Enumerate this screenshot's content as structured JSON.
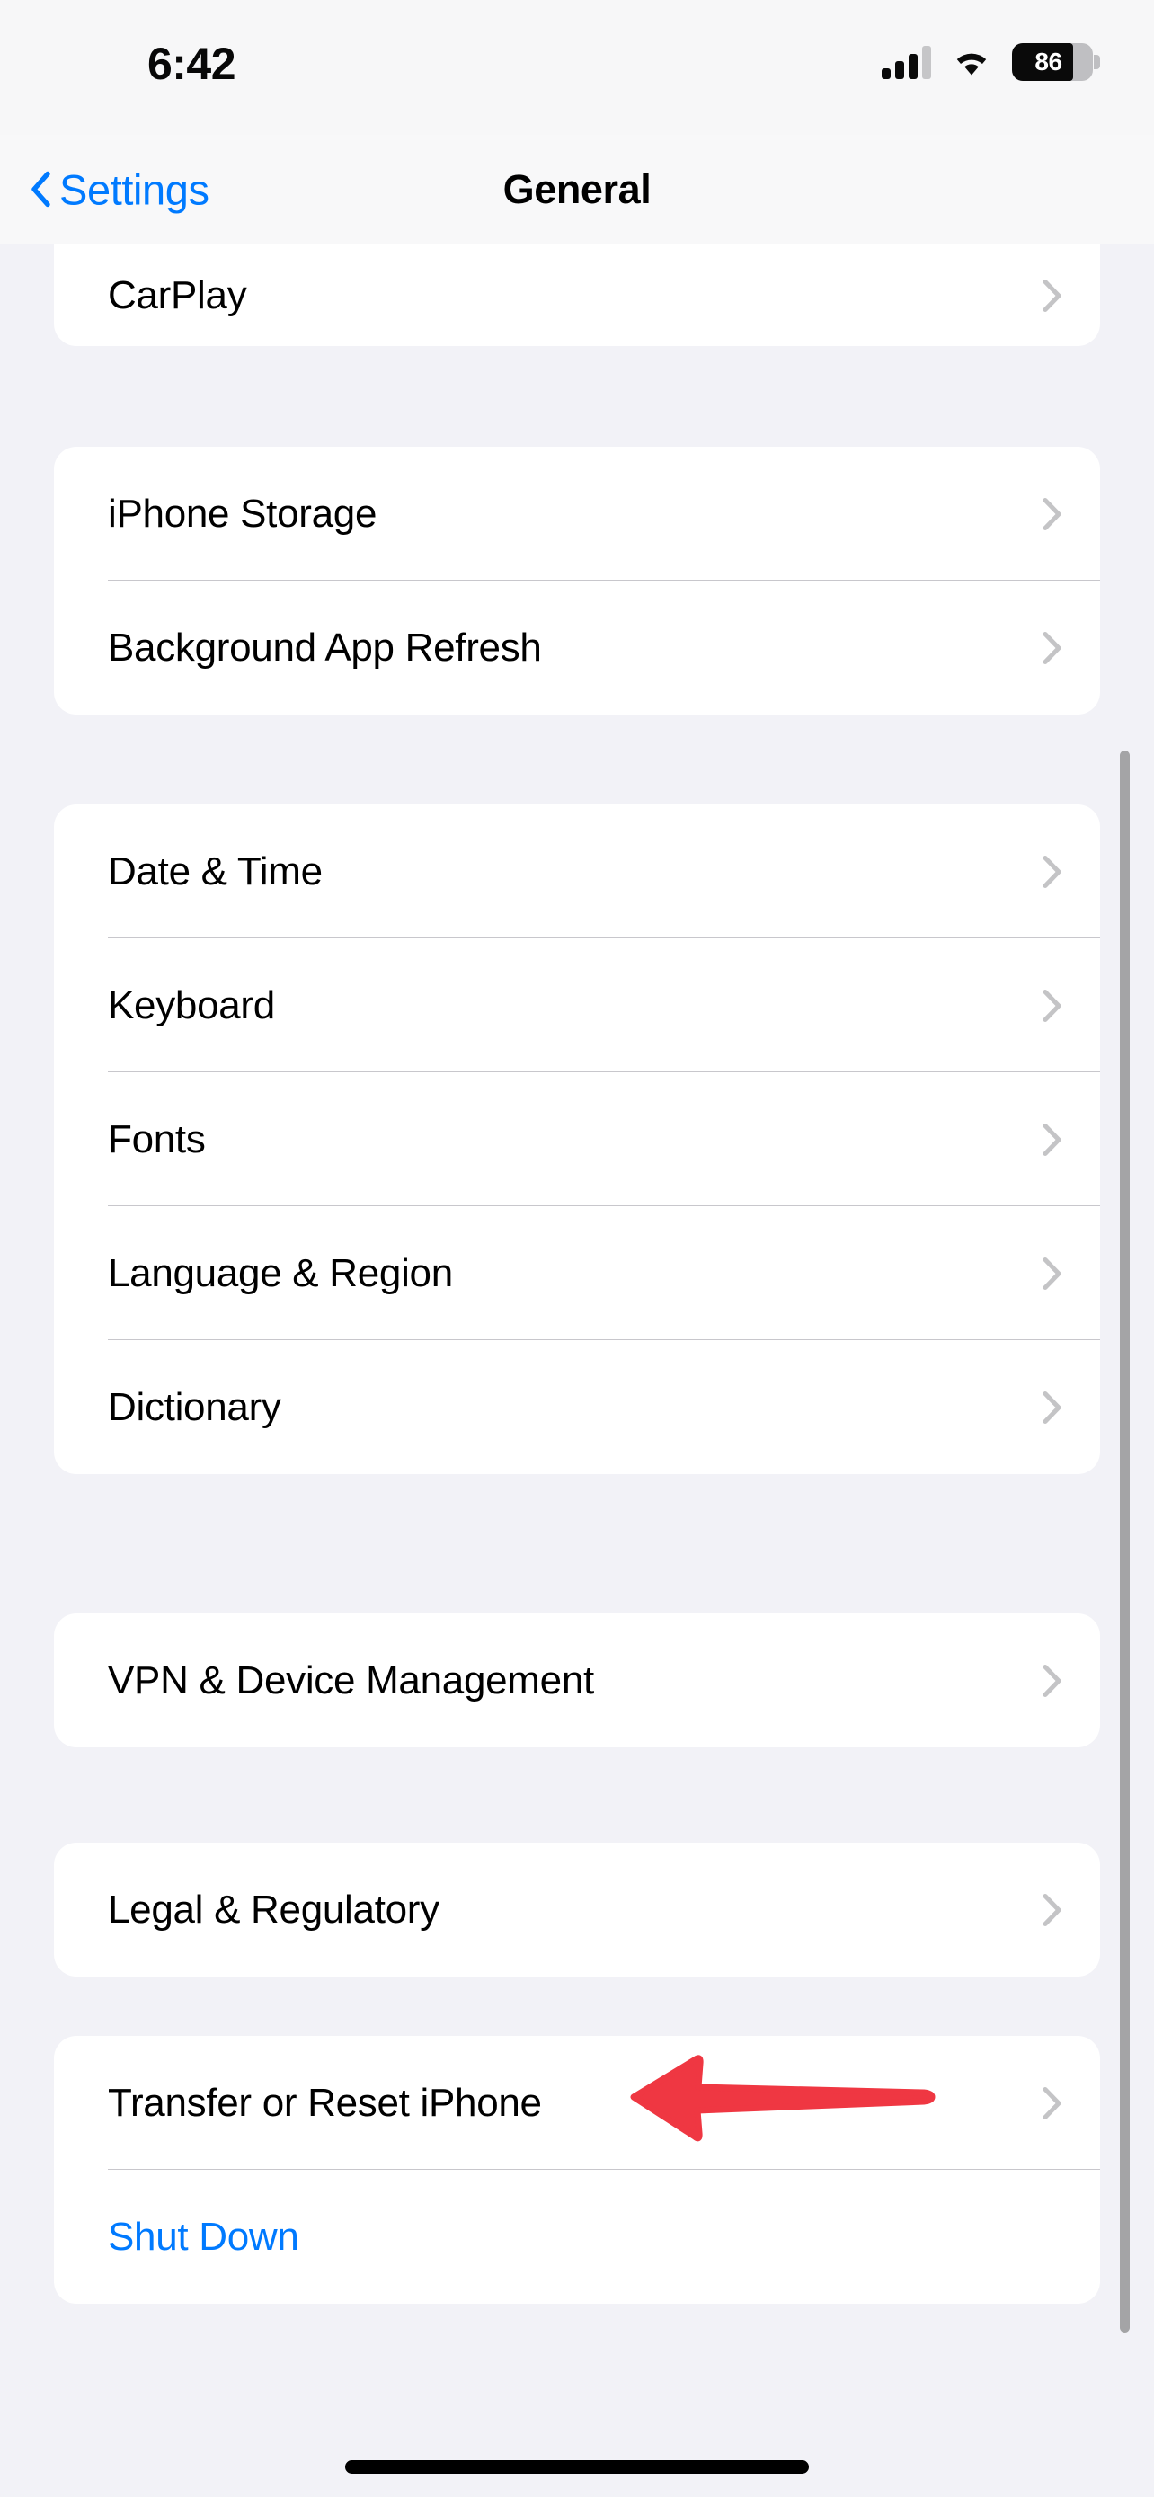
{
  "status_bar": {
    "time": "6:42",
    "cellular_icon": "cellular-signal-icon",
    "cellular_bars_total": 4,
    "cellular_bars_filled": 3,
    "wifi_icon": "wifi-icon",
    "battery_icon": "battery-icon",
    "battery_percent": "86"
  },
  "nav_bar": {
    "back_label": "Settings",
    "back_icon": "chevron-left-icon",
    "title": "General"
  },
  "colors": {
    "accent_blue": "#007AFF",
    "annotation_red": "#EF3742",
    "page_background": "#F2F2F7",
    "card_background": "#FFFFFF",
    "separator": "#C8C7CC",
    "chevron_gray": "#C4C4C6"
  },
  "sections": [
    {
      "id": "connectivity",
      "clipped_top": true,
      "rows": [
        {
          "label": "CarPlay",
          "accessory": "chevron-right-icon",
          "style": "default"
        }
      ]
    },
    {
      "id": "storage",
      "clipped_top": false,
      "rows": [
        {
          "label": "iPhone Storage",
          "accessory": "chevron-right-icon",
          "style": "default"
        },
        {
          "label": "Background App Refresh",
          "accessory": "chevron-right-icon",
          "style": "default"
        }
      ]
    },
    {
      "id": "localization",
      "clipped_top": false,
      "rows": [
        {
          "label": "Date & Time",
          "accessory": "chevron-right-icon",
          "style": "default"
        },
        {
          "label": "Keyboard",
          "accessory": "chevron-right-icon",
          "style": "default"
        },
        {
          "label": "Fonts",
          "accessory": "chevron-right-icon",
          "style": "default"
        },
        {
          "label": "Language & Region",
          "accessory": "chevron-right-icon",
          "style": "default"
        },
        {
          "label": "Dictionary",
          "accessory": "chevron-right-icon",
          "style": "default"
        }
      ]
    },
    {
      "id": "management",
      "clipped_top": false,
      "rows": [
        {
          "label": "VPN & Device Management",
          "accessory": "chevron-right-icon",
          "style": "default"
        }
      ]
    },
    {
      "id": "legal",
      "clipped_top": false,
      "rows": [
        {
          "label": "Legal & Regulatory",
          "accessory": "chevron-right-icon",
          "style": "default"
        }
      ]
    },
    {
      "id": "reset",
      "clipped_top": false,
      "rows": [
        {
          "label": "Transfer or Reset iPhone",
          "accessory": "chevron-right-icon",
          "style": "default"
        },
        {
          "label": "Shut Down",
          "accessory": "none",
          "style": "accent"
        }
      ]
    }
  ],
  "annotation": {
    "type": "arrow",
    "direction": "left",
    "color": "#EF3742",
    "points_at": "Transfer or Reset iPhone"
  },
  "scroll_indicator": {
    "visible": true
  },
  "home_indicator": {
    "visible": true
  }
}
